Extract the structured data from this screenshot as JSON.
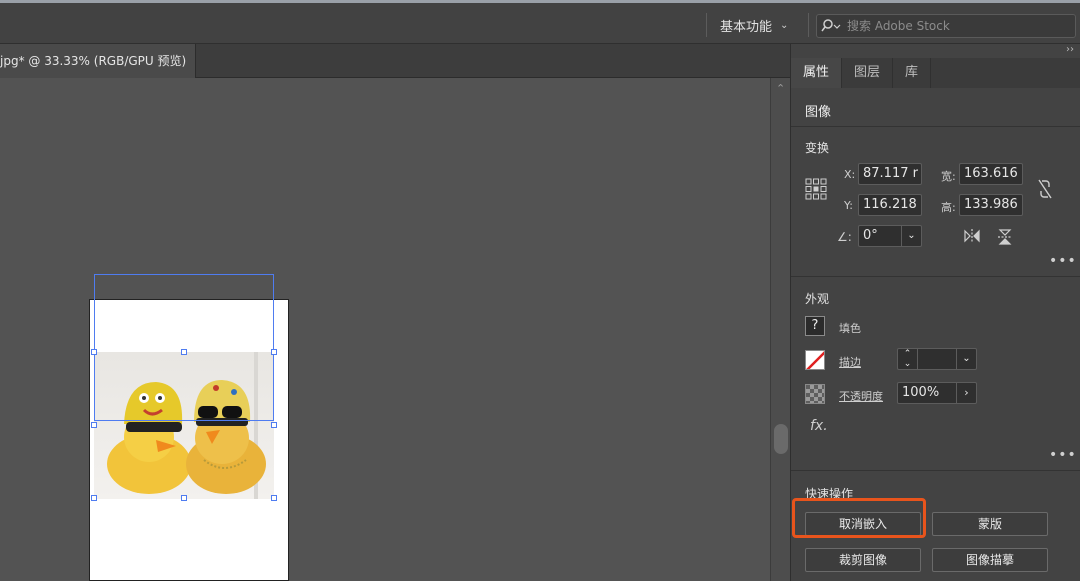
{
  "topbar": {
    "workspace_label": "基本功能",
    "stock_search_placeholder": "搜索 Adobe Stock"
  },
  "document": {
    "tab_title": "jpg* @ 33.33% (RGB/GPU 预览)"
  },
  "panel": {
    "tabs": [
      {
        "label": "属性",
        "active": true
      },
      {
        "label": "图层",
        "active": false
      },
      {
        "label": "库",
        "active": false
      }
    ],
    "object_type": "图像",
    "transform": {
      "title": "变换",
      "x_label": "X:",
      "x_value": "87.117 r",
      "y_label": "Y:",
      "y_value": "116.218",
      "w_label": "宽:",
      "w_value": "163.616",
      "h_label": "高:",
      "h_value": "133.986",
      "angle_label": "∠:",
      "angle_value": "0°"
    },
    "appearance": {
      "title": "外观",
      "fill_label": "填色",
      "stroke_label": "描边",
      "opacity_label": "不透明度",
      "opacity_value": "100%",
      "fx_label": "fx."
    },
    "quick_actions": {
      "title": "快速操作",
      "unembed_label": "取消嵌入",
      "mask_label": "蒙版",
      "crop_label": "裁剪图像",
      "trace_label": "图像描摹"
    }
  },
  "colors": {
    "selection": "#4f7cf0",
    "highlight": "#e8541c"
  }
}
